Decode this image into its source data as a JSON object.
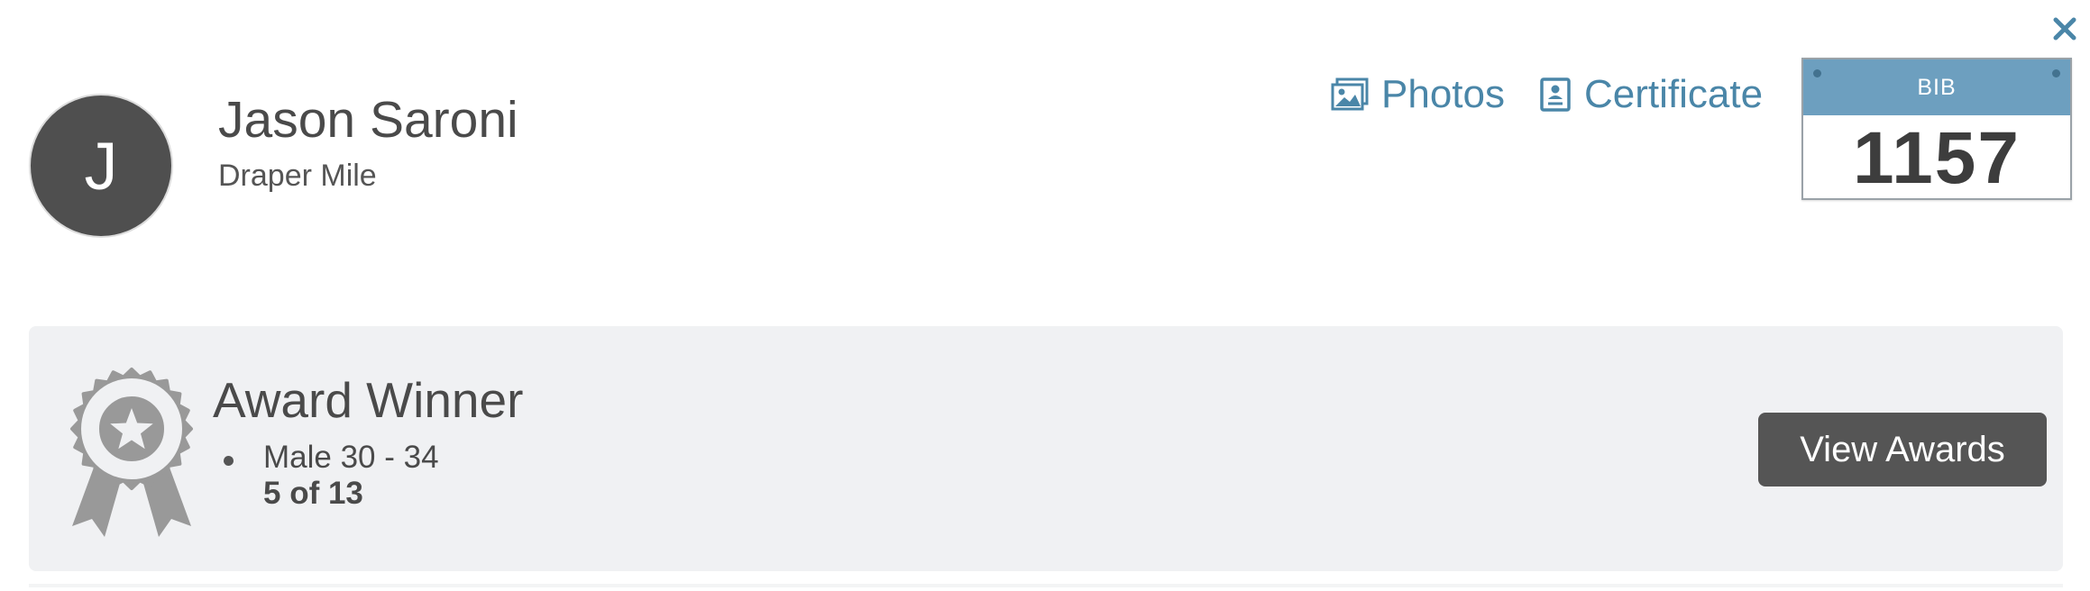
{
  "window": {
    "close_icon": "close-icon"
  },
  "runner": {
    "avatar_initial": "J",
    "name": "Jason Saroni",
    "event": "Draper Mile"
  },
  "actions": {
    "photos_label": "Photos",
    "photos_icon": "image-icon",
    "certificate_label": "Certificate",
    "certificate_icon": "certificate-icon"
  },
  "bib": {
    "label": "BIB",
    "number": "1157"
  },
  "award": {
    "icon": "award-ribbon-icon",
    "title": "Award Winner",
    "category": "Male 30 - 34",
    "rank": "5 of 13",
    "button_label": "View Awards"
  },
  "colors": {
    "accent": "#4a86a8",
    "bib_header": "#6d9fbf",
    "avatar_bg": "#4f4f4f",
    "panel_bg": "#f0f1f3",
    "button_bg": "#555555",
    "ribbon": "#999999"
  }
}
